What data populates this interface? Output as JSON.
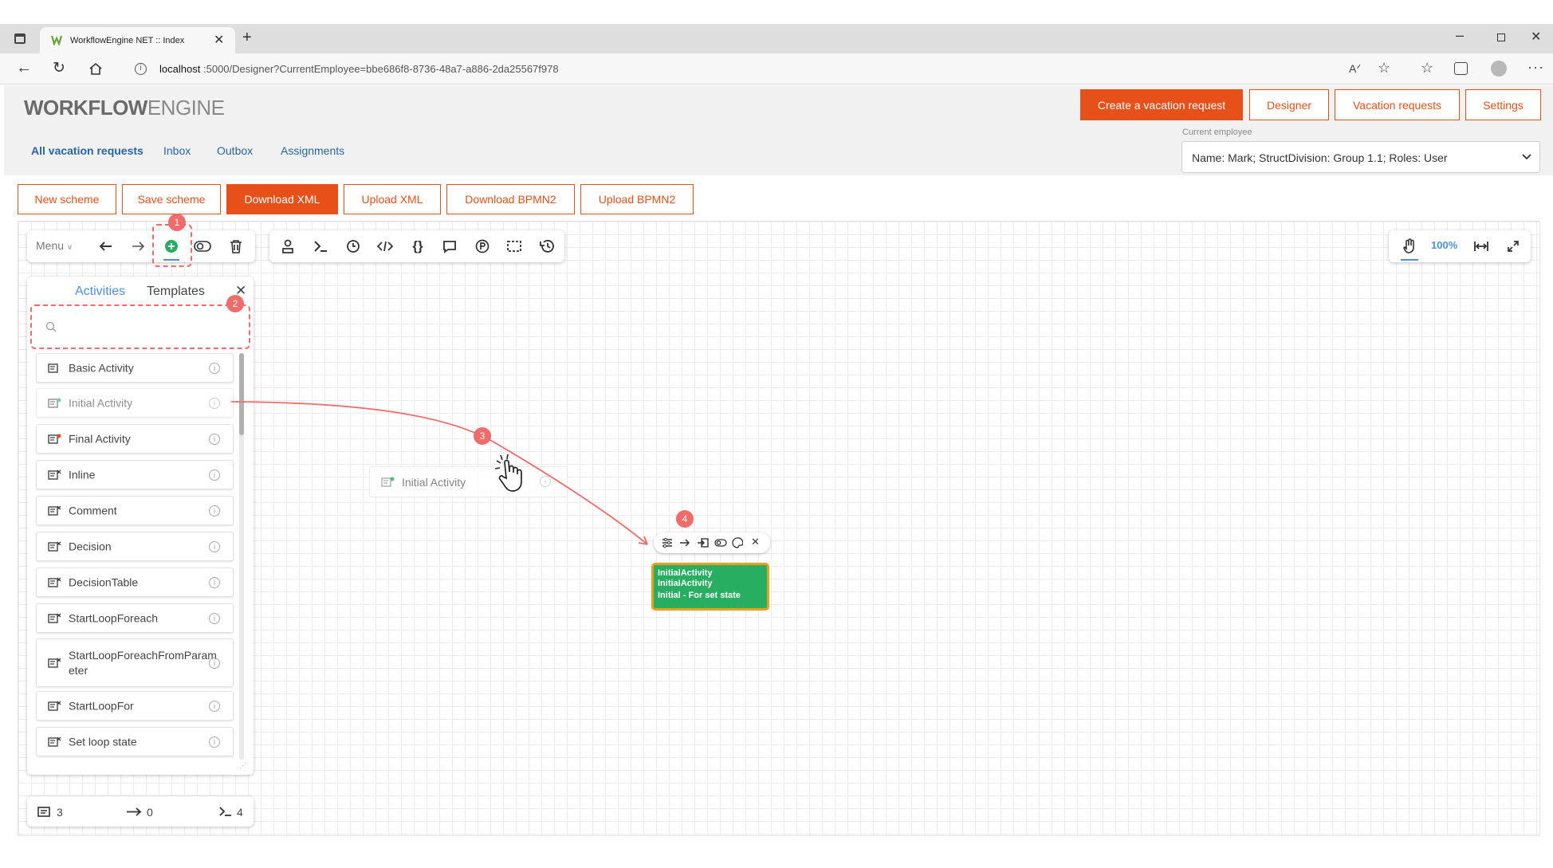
{
  "browser": {
    "tab_title": "WorkflowEngine NET :: Index",
    "url_host": "localhost",
    "url_rest": ":5000/Designer?CurrentEmployee=bbe686f8-8736-48a7-a886-2da25567f978"
  },
  "header": {
    "logo_bold": "WORKFLOW",
    "logo_light": "ENGINE",
    "buttons": [
      "Create a vacation request",
      "Designer",
      "Vacation requests",
      "Settings"
    ]
  },
  "nav": {
    "links": [
      "All vacation requests",
      "Inbox",
      "Outbox",
      "Assignments"
    ],
    "employee_label": "Current employee",
    "employee_value": "Name: Mark; StructDivision: Group 1.1; Roles: User"
  },
  "scheme_toolbar": [
    "New scheme",
    "Save scheme",
    "Download XML",
    "Upload XML",
    "Download BPMN2",
    "Upload BPMN2"
  ],
  "designer": {
    "menu_label": "Menu",
    "zoom": "100%",
    "tabs": [
      "Activities",
      "Templates"
    ],
    "search_placeholder": "",
    "activities": [
      "Basic Activity",
      "Initial Activity",
      "Final Activity",
      "Inline",
      "Comment",
      "Decision",
      "DecisionTable",
      "StartLoopForeach",
      "StartLoopForeachFromParameter",
      "StartLoopFor",
      "Set loop state"
    ],
    "drag_ghost_label": "Initial Activity",
    "node": {
      "line1": "InitialActivity",
      "line2": "InitialActivity",
      "line3": "Initial - For set state",
      "color": "#27ae60",
      "border": "#e8a020"
    },
    "stats": {
      "activities": "3",
      "transitions": "0",
      "commands": "4"
    }
  },
  "annotations": {
    "steps": [
      "1",
      "2",
      "3",
      "4"
    ],
    "color": "#f06b6b"
  },
  "icons": [
    "sidebar-toggle-icon",
    "workflow-logo-icon",
    "close-icon",
    "plus-icon",
    "back-icon",
    "refresh-icon",
    "home-icon",
    "info-icon",
    "read-aloud-icon",
    "favorite-icon",
    "favorites-icon",
    "collections-icon",
    "profile-icon",
    "more-icon",
    "undo-icon",
    "redo-icon",
    "add-icon",
    "toggle-icon",
    "trash-icon",
    "actor-icon",
    "command-icon",
    "timer-icon",
    "code-icon",
    "parameters-icon",
    "comment-icon",
    "process-icon",
    "select-icon",
    "history-icon",
    "hand-icon",
    "fit-width-icon",
    "fullscreen-icon"
  ]
}
